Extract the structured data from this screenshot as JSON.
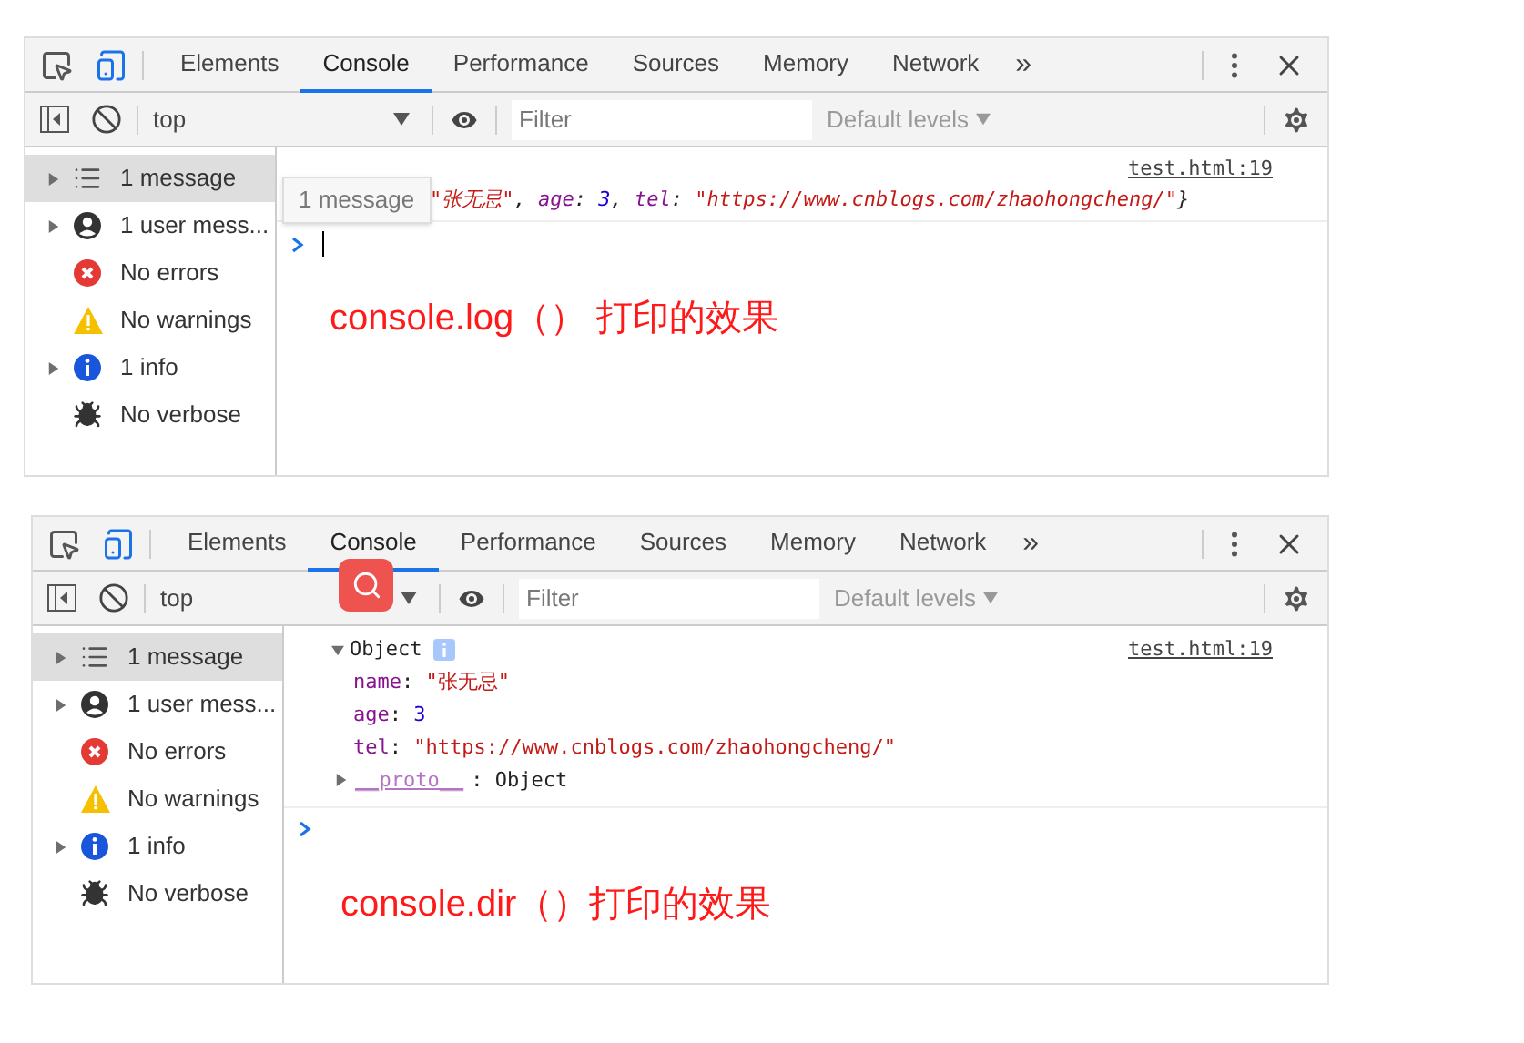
{
  "panels": [
    {
      "tabs": [
        {
          "label": "Elements",
          "selected": false
        },
        {
          "label": "Console",
          "selected": true
        },
        {
          "label": "Performance",
          "selected": false
        },
        {
          "label": "Sources",
          "selected": false
        },
        {
          "label": "Memory",
          "selected": false
        },
        {
          "label": "Network",
          "selected": false
        }
      ],
      "more_tabs": "»",
      "context": "top",
      "filter_placeholder": "Filter",
      "levels": "Default levels",
      "overlay_badge": false,
      "sidebar": [
        {
          "label": "1 message",
          "kind": "list",
          "expandable": true,
          "selected": true
        },
        {
          "label": "1 user mess...",
          "kind": "user",
          "expandable": true,
          "selected": false
        },
        {
          "label": "No errors",
          "kind": "error",
          "expandable": false,
          "selected": false
        },
        {
          "label": "No warnings",
          "kind": "warning",
          "expandable": false,
          "selected": false
        },
        {
          "label": "1 info",
          "kind": "info",
          "expandable": true,
          "selected": false
        },
        {
          "label": "No verbose",
          "kind": "verbose",
          "expandable": false,
          "selected": false
        }
      ],
      "log": {
        "kind": "inline",
        "source": "test.html:19",
        "tooltip": "1 message",
        "tokens": [
          {
            "text": "\"张无忌\"",
            "kind": "string"
          },
          {
            "text": ", ",
            "kind": "punct"
          },
          {
            "text": "age",
            "kind": "key"
          },
          {
            "text": ": ",
            "kind": "punct"
          },
          {
            "text": "3",
            "kind": "number"
          },
          {
            "text": ", ",
            "kind": "punct"
          },
          {
            "text": "tel",
            "kind": "key"
          },
          {
            "text": ": ",
            "kind": "punct"
          },
          {
            "text": "\"https://www.cnblogs.com/zhaohongcheng/\"",
            "kind": "string"
          },
          {
            "text": "}",
            "kind": "punct"
          }
        ]
      },
      "annotation": "console.log（） 打印的效果"
    },
    {
      "tabs": [
        {
          "label": "Elements",
          "selected": false
        },
        {
          "label": "Console",
          "selected": true
        },
        {
          "label": "Performance",
          "selected": false
        },
        {
          "label": "Sources",
          "selected": false
        },
        {
          "label": "Memory",
          "selected": false
        },
        {
          "label": "Network",
          "selected": false
        }
      ],
      "more_tabs": "»",
      "context": "top",
      "filter_placeholder": "Filter",
      "levels": "Default levels",
      "overlay_badge": true,
      "sidebar": [
        {
          "label": "1 message",
          "kind": "list",
          "expandable": true,
          "selected": true
        },
        {
          "label": "1 user mess...",
          "kind": "user",
          "expandable": true,
          "selected": false
        },
        {
          "label": "No errors",
          "kind": "error",
          "expandable": false,
          "selected": false
        },
        {
          "label": "No warnings",
          "kind": "warning",
          "expandable": false,
          "selected": false
        },
        {
          "label": "1 info",
          "kind": "info",
          "expandable": true,
          "selected": false
        },
        {
          "label": "No verbose",
          "kind": "verbose",
          "expandable": false,
          "selected": false
        }
      ],
      "log": {
        "kind": "object",
        "source": "test.html:19",
        "label": "Object",
        "expanded": true,
        "properties": [
          {
            "key": "name",
            "separator": ":",
            "value": "\"张无忌\"",
            "kind": "string"
          },
          {
            "key": "age",
            "separator": ":",
            "value": "3",
            "kind": "number"
          },
          {
            "key": "tel",
            "separator": ":",
            "value": "\"https://www.cnblogs.com/zhaohongcheng/\"",
            "kind": "string"
          }
        ],
        "proto": {
          "key": "__proto__",
          "separator": ":",
          "value": "Object",
          "expanded": false
        }
      },
      "annotation": "console.dir（）打印的效果"
    }
  ]
}
